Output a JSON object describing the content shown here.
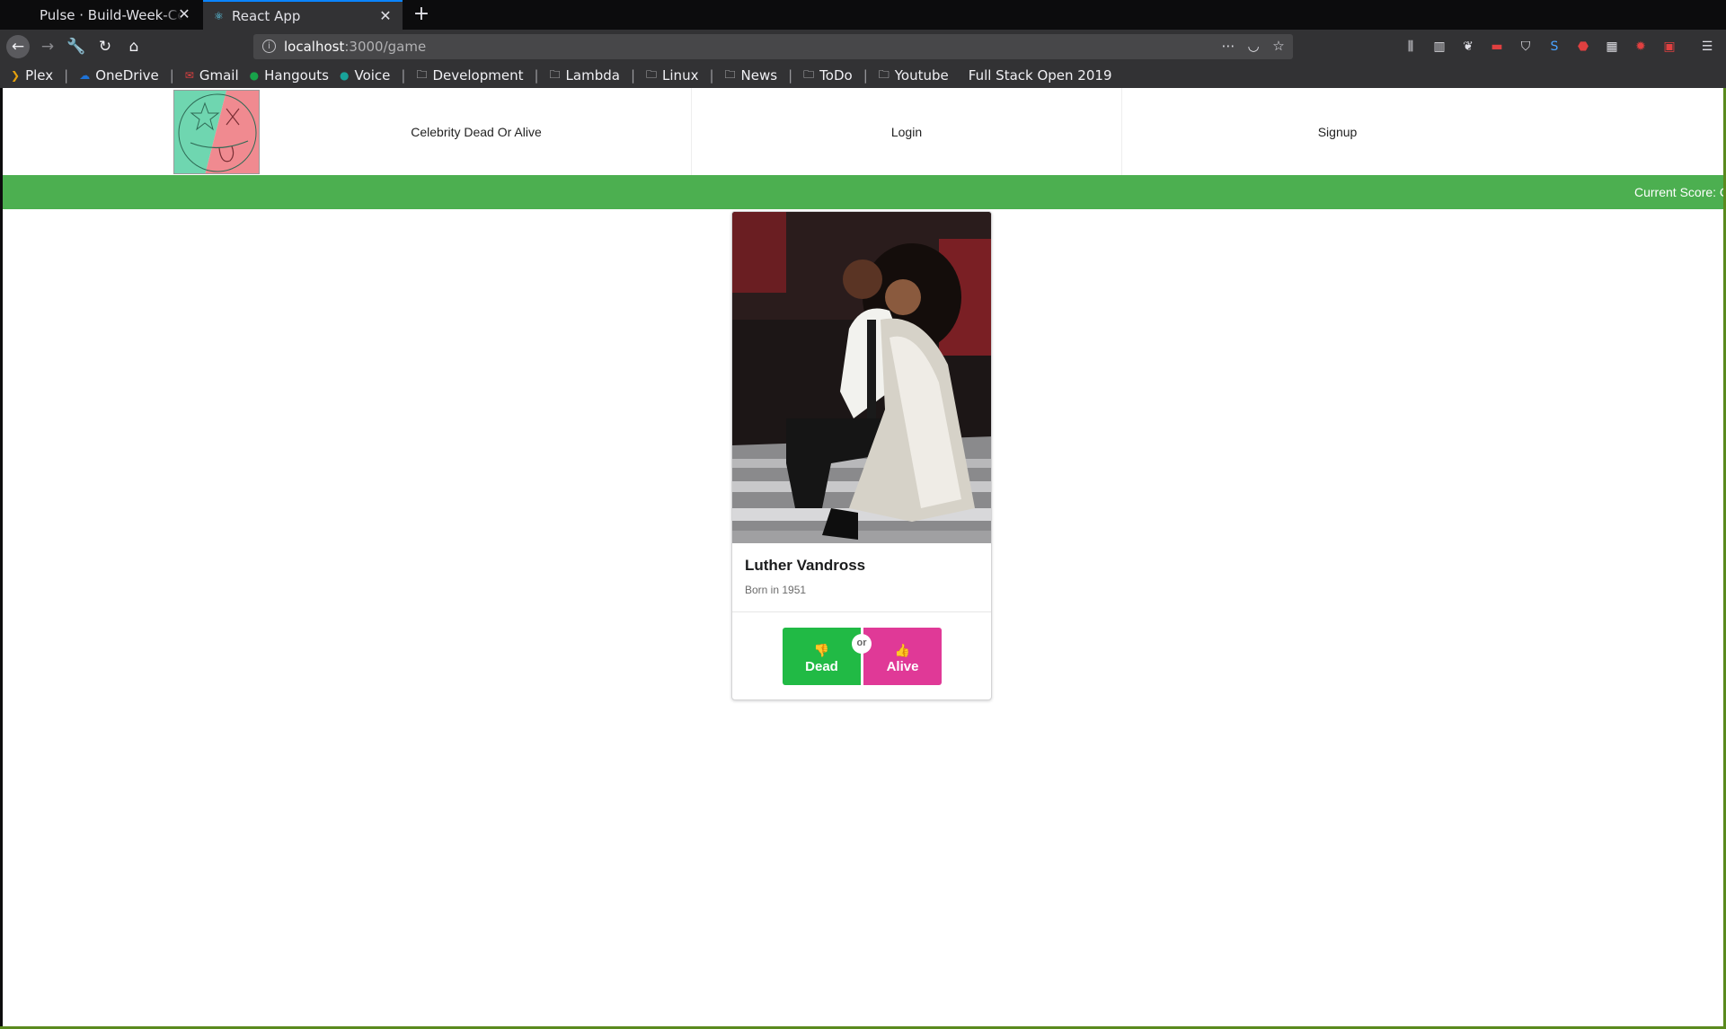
{
  "browser": {
    "tabs": [
      {
        "title": "Pulse · Build-Week-Celeb",
        "active": false
      },
      {
        "title": "React App",
        "active": true
      }
    ],
    "url": {
      "host": "localhost",
      "path": ":3000/game"
    },
    "bookmarks": [
      {
        "label": "Plex",
        "icon": "plex-icon"
      },
      {
        "label": "OneDrive",
        "icon": "cloud-icon"
      },
      {
        "label": "Gmail",
        "icon": "gmail-icon"
      },
      {
        "label": "Hangouts",
        "icon": "hangouts-icon"
      },
      {
        "label": "Voice",
        "icon": "phone-icon"
      },
      {
        "label": "Development",
        "icon": "folder-icon"
      },
      {
        "label": "Lambda",
        "icon": "folder-icon"
      },
      {
        "label": "Linux",
        "icon": "folder-icon"
      },
      {
        "label": "News",
        "icon": "folder-icon"
      },
      {
        "label": "ToDo",
        "icon": "folder-icon"
      },
      {
        "label": "Youtube",
        "icon": "folder-icon"
      },
      {
        "label": "Full Stack Open 2019",
        "icon": "page-icon"
      }
    ]
  },
  "app": {
    "nav": {
      "title": "Celebrity Dead Or Alive",
      "login": "Login",
      "signup": "Signup"
    },
    "score_label": "Current Score: C",
    "card": {
      "name": "Luther Vandross",
      "meta": "Born in 1951",
      "dead_label": "Dead",
      "or_label": "or",
      "alive_label": "Alive"
    },
    "colors": {
      "score_bar": "#4caf50",
      "dead_button": "#21ba45",
      "alive_button": "#e03997"
    }
  }
}
